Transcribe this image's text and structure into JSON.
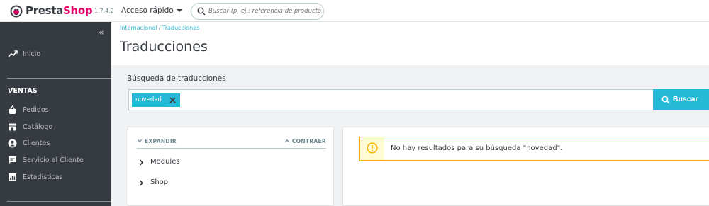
{
  "header": {
    "brand_first": "Presta",
    "brand_second": "Shop",
    "version": "1.7.4.2",
    "quick_access_label": "Acceso rápido",
    "search_placeholder": "Buscar (p. ej.: referencia de producto, n"
  },
  "sidebar": {
    "home_label": "Inicio",
    "section_title": "VENTAS",
    "items": [
      {
        "label": "Pedidos",
        "icon": "basket-icon"
      },
      {
        "label": "Catálogo",
        "icon": "store-icon"
      },
      {
        "label": "Clientes",
        "icon": "user-icon"
      },
      {
        "label": "Servicio al Cliente",
        "icon": "chat-icon"
      },
      {
        "label": "Estadísticas",
        "icon": "chart-icon"
      }
    ]
  },
  "breadcrumb": {
    "parent": "Internacional",
    "separator": " / ",
    "current": "Traducciones"
  },
  "page_title": "Traducciones",
  "search": {
    "label": "Búsqueda de traducciones",
    "tag": "novedad",
    "button_label": "Buscar"
  },
  "tree": {
    "expand_label": "EXPANDIR",
    "collapse_label": "CONTRAER",
    "items": [
      "Modules",
      "Shop"
    ]
  },
  "results": {
    "message": "No hay resultados para su búsqueda \"novedad\"."
  },
  "colors": {
    "primary": "#25b9d7",
    "sidebar_bg": "#363a41",
    "brand_pink": "#df0067",
    "warning": "#fab000"
  }
}
